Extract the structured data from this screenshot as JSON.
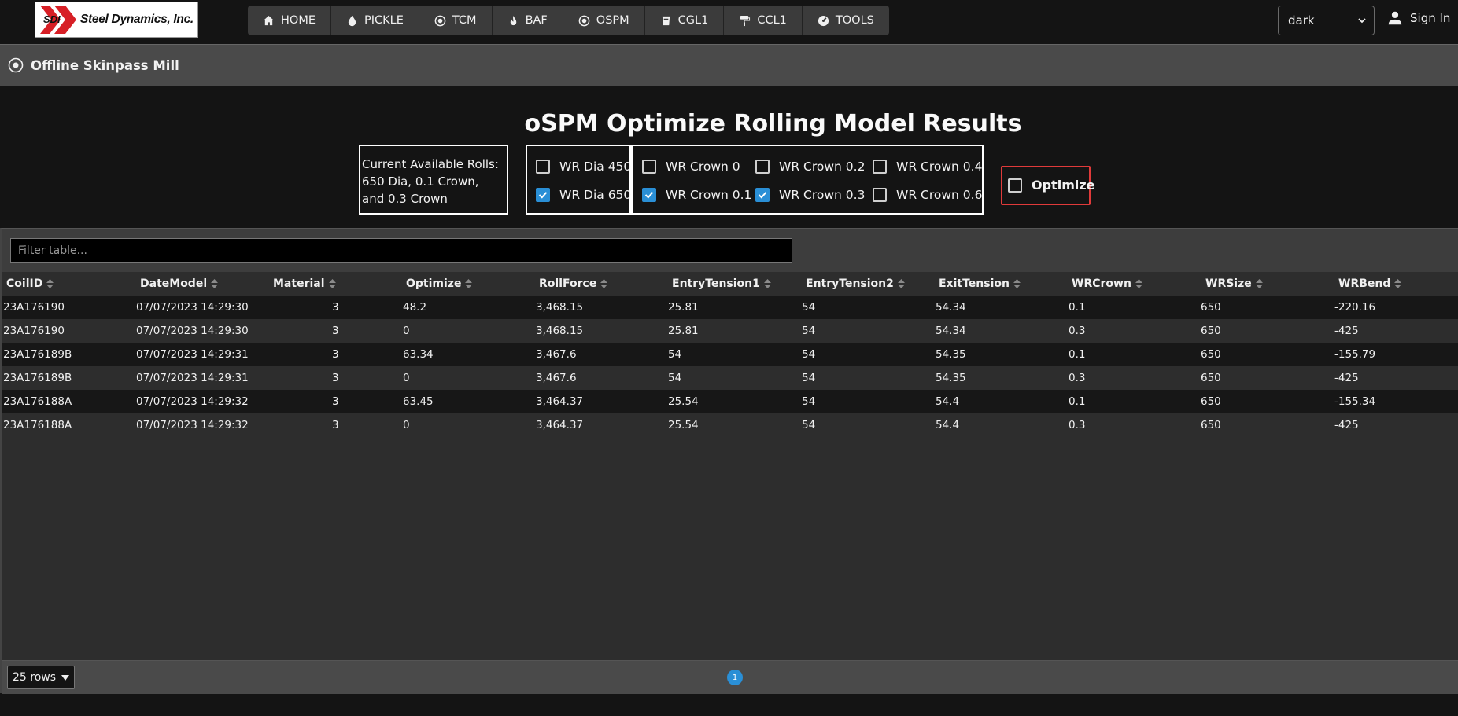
{
  "brand": {
    "name": "Steel Dynamics, Inc.",
    "mark": "SDI"
  },
  "nav": [
    {
      "label": "HOME",
      "icon": "home-icon"
    },
    {
      "label": "PICKLE",
      "icon": "droplet-icon"
    },
    {
      "label": "TCM",
      "icon": "target-icon"
    },
    {
      "label": "BAF",
      "icon": "flame-icon"
    },
    {
      "label": "OSPM",
      "icon": "target-icon"
    },
    {
      "label": "CGL1",
      "icon": "bucket-icon"
    },
    {
      "label": "CCL1",
      "icon": "paint-roller-icon"
    },
    {
      "label": "TOOLS",
      "icon": "gauge-icon"
    }
  ],
  "theme": {
    "selected": "dark"
  },
  "auth": {
    "signin_label": "Sign In"
  },
  "subheader": {
    "title": "Offline Skinpass Mill"
  },
  "page": {
    "title": "oSPM Optimize Rolling Model Results"
  },
  "rolls_info": "Current Available Rolls: 650 Dia, 0.1 Crown, and 0.3 Crown",
  "options": {
    "wr_dia_450": {
      "label": "WR Dia 450",
      "checked": false
    },
    "wr_dia_650": {
      "label": "WR Dia 650",
      "checked": true
    },
    "wr_crown_0": {
      "label": "WR Crown 0",
      "checked": false
    },
    "wr_crown_0_1": {
      "label": "WR Crown 0.1",
      "checked": true
    },
    "wr_crown_0_2": {
      "label": "WR Crown 0.2",
      "checked": false
    },
    "wr_crown_0_3": {
      "label": "WR Crown 0.3",
      "checked": true
    },
    "wr_crown_0_4": {
      "label": "WR Crown 0.4",
      "checked": false
    },
    "wr_crown_0_6": {
      "label": "WR Crown 0.6",
      "checked": false
    },
    "optimize": {
      "label": "Optimize",
      "checked": false
    }
  },
  "table": {
    "filter_placeholder": "Filter table...",
    "columns": [
      "CoilID",
      "DateModel",
      "Material",
      "Optimize",
      "RollForce",
      "EntryTension1",
      "EntryTension2",
      "ExitTension",
      "WRCrown",
      "WRSize",
      "WRBend"
    ],
    "rows": [
      [
        "23A176190",
        "07/07/2023 14:29:30",
        "3",
        "48.2",
        "3,468.15",
        "25.81",
        "54",
        "54.34",
        "0.1",
        "650",
        "-220.16"
      ],
      [
        "23A176190",
        "07/07/2023 14:29:30",
        "3",
        "0",
        "3,468.15",
        "25.81",
        "54",
        "54.34",
        "0.3",
        "650",
        "-425"
      ],
      [
        "23A176189B",
        "07/07/2023 14:29:31",
        "3",
        "63.34",
        "3,467.6",
        "54",
        "54",
        "54.35",
        "0.1",
        "650",
        "-155.79"
      ],
      [
        "23A176189B",
        "07/07/2023 14:29:31",
        "3",
        "0",
        "3,467.6",
        "54",
        "54",
        "54.35",
        "0.3",
        "650",
        "-425"
      ],
      [
        "23A176188A",
        "07/07/2023 14:29:32",
        "3",
        "63.45",
        "3,464.37",
        "25.54",
        "54",
        "54.4",
        "0.1",
        "650",
        "-155.34"
      ],
      [
        "23A176188A",
        "07/07/2023 14:29:32",
        "3",
        "0",
        "3,464.37",
        "25.54",
        "54",
        "54.4",
        "0.3",
        "650",
        "-425"
      ]
    ]
  },
  "pagination": {
    "rows_per_page": "25 rows",
    "current_page": "1"
  },
  "colors": {
    "accent": "#2a8fd6",
    "highlight_border": "#e03a3a"
  }
}
